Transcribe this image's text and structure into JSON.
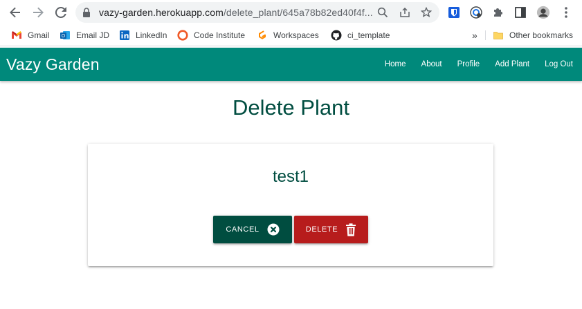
{
  "browser": {
    "url_host": "vazy-garden.herokuapp.com",
    "url_path": "/delete_plant/645a78b82ed40f4f...",
    "icons": {
      "back": "arrow-left-icon",
      "forward": "arrow-right-icon",
      "reload": "reload-icon",
      "lock": "lock-icon",
      "zoom": "zoom-icon",
      "share": "share-icon",
      "bookmark": "star-icon",
      "extensions": [
        "bitwarden-icon",
        "grammarly-icon",
        "puzzle-icon",
        "sidepanel-icon",
        "avatar",
        "menu-icon"
      ]
    }
  },
  "bookmarks": {
    "items": [
      {
        "label": "Gmail",
        "icon": "gmail-icon"
      },
      {
        "label": "Email JD",
        "icon": "outlook-icon"
      },
      {
        "label": "LinkedIn",
        "icon": "linkedin-icon"
      },
      {
        "label": "Code Institute",
        "icon": "code-institute-icon"
      },
      {
        "label": "Workspaces",
        "icon": "gitpod-icon"
      },
      {
        "label": "ci_template",
        "icon": "github-icon"
      }
    ],
    "overflow": "»",
    "other_label": "Other bookmarks"
  },
  "site": {
    "brand": "Vazy Garden",
    "nav": [
      "Home",
      "About",
      "Profile",
      "Add Plant",
      "Log Out"
    ],
    "color": "#00897b"
  },
  "page": {
    "title": "Delete Plant",
    "plant_name": "test1",
    "cancel_label": "CANCEL",
    "delete_label": "DELETE",
    "cancel_color": "#004d40",
    "delete_color": "#b71c1c"
  }
}
